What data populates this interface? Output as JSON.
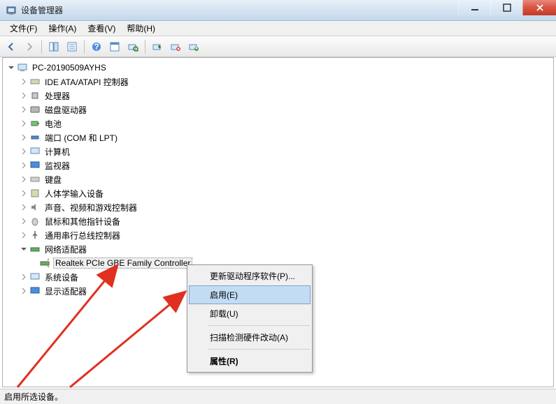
{
  "window": {
    "title": "设备管理器"
  },
  "menu": {
    "file": "文件(F)",
    "action": "操作(A)",
    "view": "查看(V)",
    "help": "帮助(H)"
  },
  "tree": {
    "root": "PC-20190509AYHS",
    "items": [
      "IDE ATA/ATAPI 控制器",
      "处理器",
      "磁盘驱动器",
      "电池",
      "端口 (COM 和 LPT)",
      "计算机",
      "监视器",
      "键盘",
      "人体学输入设备",
      "声音、视频和游戏控制器",
      "鼠标和其他指针设备",
      "通用串行总线控制器",
      "网络适配器",
      "系统设备",
      "显示适配器"
    ],
    "selected_child": "Realtek PCIe GBE Family Controller"
  },
  "context_menu": {
    "update": "更新驱动程序软件(P)...",
    "enable": "启用(E)",
    "uninstall": "卸载(U)",
    "scan": "扫描检测硬件改动(A)",
    "properties": "属性(R)"
  },
  "status": "启用所选设备。"
}
